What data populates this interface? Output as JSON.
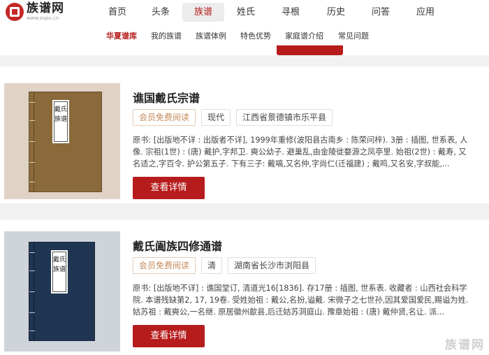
{
  "logo": {
    "title": "族谱网",
    "sub": "www.zupu.cn"
  },
  "nav": [
    {
      "label": "首页"
    },
    {
      "label": "头条"
    },
    {
      "label": "族谱"
    },
    {
      "label": "姓氏"
    },
    {
      "label": "寻根"
    },
    {
      "label": "历史"
    },
    {
      "label": "问答"
    },
    {
      "label": "应用"
    }
  ],
  "nav_active": "族谱",
  "subnav": [
    {
      "label": "华夏谱库"
    },
    {
      "label": "我的族谱"
    },
    {
      "label": "族谱体例"
    },
    {
      "label": "特色优势"
    },
    {
      "label": "家庭谱介绍"
    },
    {
      "label": "常见问题"
    }
  ],
  "subnav_active": "华夏谱库",
  "cards": [
    {
      "title": "谯国戴氏宗谱",
      "cover_label": "戴氏族谱",
      "tags": [
        "会员免费阅读",
        "现代",
        "江西省景德镇市乐平县"
      ],
      "desc": "原书: [出版地不详 : 出版者不详], 1999年重修(波阳县古南乡 : 陈荣问梓). 3册 : 插图, 世系表, 人像. 宗祖(1世) : (唐) 戴护,字邦卫. 奭公幼子. 避巢乱,由金陵徙婺源之凤亭里. 始祖(2世) : 戴寿, 又名适之,字百令. 护公第五子. 下有三子: 戴嗃,又名仲,字尚仁(迁福建) ; 戴鸣,又名安,字叔能,...",
      "button": "查看详情"
    },
    {
      "title": "戴氏阖族四修通谱",
      "cover_label": "戴氏族谱",
      "tags": [
        "会员免费阅读",
        "清",
        "湖南省长沙市浏阳县"
      ],
      "desc": "原书: [出版地不详] : 谯国堂订, 清道光16[1836]. 存17册 : 插图, 世系表. 收藏者 : 山西社会科学院. 本谱残缺第2, 17, 19卷. 受姓始祖 : 戴公,名扮,谥戴. 宋微子之七世孙,因其爱国爱民,赐谥为姓. 姑苏祖 : 戴奭公,一名继. 原居徽州歙县,后迁姑苏洞庭山. 豫章始祖 : (唐) 戴仲贤,名让. 派...",
      "button": "查看详情"
    }
  ],
  "watermark": "族谱网",
  "colors": {
    "brand": "#b71c1c",
    "free_tag": "#c48a5a"
  }
}
